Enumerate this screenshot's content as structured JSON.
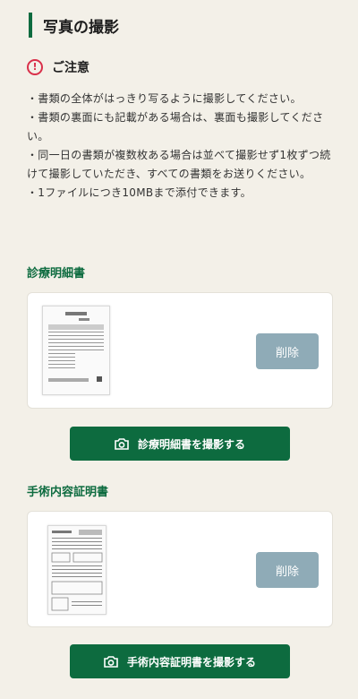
{
  "section": {
    "title": "写真の撮影"
  },
  "notice": {
    "icon": "alert-circle-icon",
    "icon_glyph": "!",
    "title": "ご注意",
    "lines": [
      "・書類の全体がはっきり写るように撮影してください。",
      "・書類の裏面にも記載がある場合は、裏面も撮影してください。",
      "・同一日の書類が複数枚ある場合は並べて撮影せず1枚ずつ続けて撮影していただき、すべての書類をお送りください。",
      "・1ファイルにつき10MBまで添付できます。"
    ]
  },
  "documents": [
    {
      "label": "診療明細書",
      "delete_label": "削除",
      "shoot_label": "診療明細書を撮影する",
      "shoot_icon": "camera-icon"
    },
    {
      "label": "手術内容証明書",
      "delete_label": "削除",
      "shoot_label": "手術内容証明書を撮影する",
      "shoot_icon": "camera-icon"
    }
  ],
  "colors": {
    "accent": "#0d6b3f",
    "alert": "#d9304a",
    "delete_button": "#8fabb7",
    "background": "#f3f0e8"
  }
}
